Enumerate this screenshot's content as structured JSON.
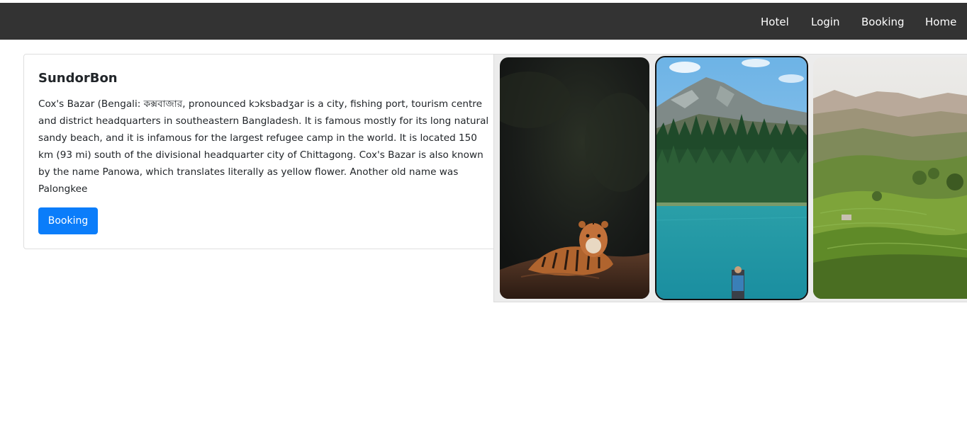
{
  "nav": {
    "items": [
      "Hotel",
      "Login",
      "Booking",
      "Home"
    ]
  },
  "card": {
    "title": "SundorBon",
    "text_lines": [
      "Cox's Bazar (Bengali: কক্সবাজার, pronounced kɔksbadʒar is a city, fishing port, tourism centre",
      "and district headquarters in southeastern Bangladesh. It is famous mostly for its long natural",
      "sandy beach, and it is infamous for the largest refugee camp in the world. It is located 150",
      "km (93 mi) south of the divisional headquarter city of Chittagong. Cox's Bazar is also known",
      "by the name Panowa, which translates literally as yellow flower. Another old name was",
      "Palongkee"
    ],
    "button_label": "Booking",
    "button_color": "#0b7dfa"
  },
  "gallery": {
    "images": [
      {
        "subject": "tiger-photo"
      },
      {
        "subject": "mountain-lake-photo",
        "selected": true
      },
      {
        "subject": "tea-hills-photo"
      }
    ]
  },
  "colors": {
    "navbar_bg": "#333333",
    "nav_text": "#ffffff"
  }
}
